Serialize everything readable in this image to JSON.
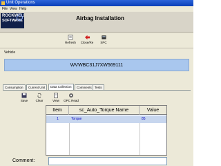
{
  "window": {
    "title": "Unit Operations"
  },
  "menu": {
    "items": [
      "File",
      "View",
      "Help"
    ]
  },
  "header": {
    "logo_line1": "ROCKWELL",
    "logo_line2": "SOFTWARE",
    "app_title": "Airbag Installation"
  },
  "toolbar": {
    "buttons": [
      {
        "label": "Refresh",
        "icon": "refresh-icon"
      },
      {
        "label": "Close/Re",
        "icon": "close-icon"
      },
      {
        "label": "SPC",
        "icon": "spc-icon"
      }
    ]
  },
  "vehicle": {
    "label": "Vehicle",
    "vin": "WVWBC31J7XW569111"
  },
  "tabs": [
    {
      "label": "Consumption",
      "active": false
    },
    {
      "label": "Current Unit",
      "active": false
    },
    {
      "label": "Data Collection",
      "active": true
    },
    {
      "label": "Comments",
      "active": false
    },
    {
      "label": "Tests",
      "active": false
    }
  ],
  "data_collection": {
    "buttons": [
      {
        "label": "Save",
        "icon": "save-icon"
      },
      {
        "label": "Clear",
        "icon": "clear-icon"
      },
      {
        "label": "View",
        "icon": "view-icon"
      },
      {
        "label": "OPC Read",
        "icon": "opc-read-icon"
      }
    ],
    "columns": [
      "Item",
      "sc_Auto_Torque Name",
      "Value"
    ],
    "rows": [
      {
        "item": "1",
        "name": "Torque",
        "value": "85"
      }
    ],
    "comment_label": "Comment:",
    "comment_value": ""
  },
  "colors": {
    "title_bar": "#0a3fb8",
    "vin_background": "#a9c7ee",
    "selected_row": "#c7d6ee",
    "row_text": "#0000c0"
  }
}
